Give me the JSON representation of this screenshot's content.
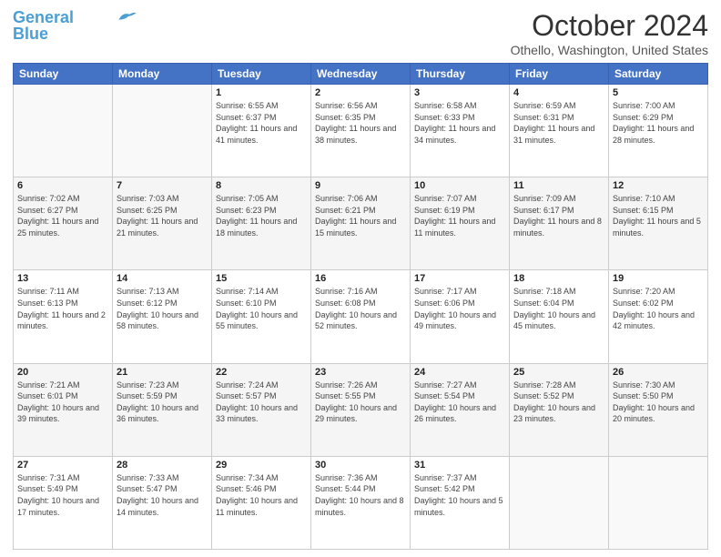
{
  "logo": {
    "line1": "General",
    "line2": "Blue"
  },
  "title": "October 2024",
  "location": "Othello, Washington, United States",
  "days_of_week": [
    "Sunday",
    "Monday",
    "Tuesday",
    "Wednesday",
    "Thursday",
    "Friday",
    "Saturday"
  ],
  "weeks": [
    [
      {
        "day": "",
        "info": ""
      },
      {
        "day": "",
        "info": ""
      },
      {
        "day": "1",
        "sunrise": "6:55 AM",
        "sunset": "6:37 PM",
        "daylight": "11 hours and 41 minutes."
      },
      {
        "day": "2",
        "sunrise": "6:56 AM",
        "sunset": "6:35 PM",
        "daylight": "11 hours and 38 minutes."
      },
      {
        "day": "3",
        "sunrise": "6:58 AM",
        "sunset": "6:33 PM",
        "daylight": "11 hours and 34 minutes."
      },
      {
        "day": "4",
        "sunrise": "6:59 AM",
        "sunset": "6:31 PM",
        "daylight": "11 hours and 31 minutes."
      },
      {
        "day": "5",
        "sunrise": "7:00 AM",
        "sunset": "6:29 PM",
        "daylight": "11 hours and 28 minutes."
      }
    ],
    [
      {
        "day": "6",
        "sunrise": "7:02 AM",
        "sunset": "6:27 PM",
        "daylight": "11 hours and 25 minutes."
      },
      {
        "day": "7",
        "sunrise": "7:03 AM",
        "sunset": "6:25 PM",
        "daylight": "11 hours and 21 minutes."
      },
      {
        "day": "8",
        "sunrise": "7:05 AM",
        "sunset": "6:23 PM",
        "daylight": "11 hours and 18 minutes."
      },
      {
        "day": "9",
        "sunrise": "7:06 AM",
        "sunset": "6:21 PM",
        "daylight": "11 hours and 15 minutes."
      },
      {
        "day": "10",
        "sunrise": "7:07 AM",
        "sunset": "6:19 PM",
        "daylight": "11 hours and 11 minutes."
      },
      {
        "day": "11",
        "sunrise": "7:09 AM",
        "sunset": "6:17 PM",
        "daylight": "11 hours and 8 minutes."
      },
      {
        "day": "12",
        "sunrise": "7:10 AM",
        "sunset": "6:15 PM",
        "daylight": "11 hours and 5 minutes."
      }
    ],
    [
      {
        "day": "13",
        "sunrise": "7:11 AM",
        "sunset": "6:13 PM",
        "daylight": "11 hours and 2 minutes."
      },
      {
        "day": "14",
        "sunrise": "7:13 AM",
        "sunset": "6:12 PM",
        "daylight": "10 hours and 58 minutes."
      },
      {
        "day": "15",
        "sunrise": "7:14 AM",
        "sunset": "6:10 PM",
        "daylight": "10 hours and 55 minutes."
      },
      {
        "day": "16",
        "sunrise": "7:16 AM",
        "sunset": "6:08 PM",
        "daylight": "10 hours and 52 minutes."
      },
      {
        "day": "17",
        "sunrise": "7:17 AM",
        "sunset": "6:06 PM",
        "daylight": "10 hours and 49 minutes."
      },
      {
        "day": "18",
        "sunrise": "7:18 AM",
        "sunset": "6:04 PM",
        "daylight": "10 hours and 45 minutes."
      },
      {
        "day": "19",
        "sunrise": "7:20 AM",
        "sunset": "6:02 PM",
        "daylight": "10 hours and 42 minutes."
      }
    ],
    [
      {
        "day": "20",
        "sunrise": "7:21 AM",
        "sunset": "6:01 PM",
        "daylight": "10 hours and 39 minutes."
      },
      {
        "day": "21",
        "sunrise": "7:23 AM",
        "sunset": "5:59 PM",
        "daylight": "10 hours and 36 minutes."
      },
      {
        "day": "22",
        "sunrise": "7:24 AM",
        "sunset": "5:57 PM",
        "daylight": "10 hours and 33 minutes."
      },
      {
        "day": "23",
        "sunrise": "7:26 AM",
        "sunset": "5:55 PM",
        "daylight": "10 hours and 29 minutes."
      },
      {
        "day": "24",
        "sunrise": "7:27 AM",
        "sunset": "5:54 PM",
        "daylight": "10 hours and 26 minutes."
      },
      {
        "day": "25",
        "sunrise": "7:28 AM",
        "sunset": "5:52 PM",
        "daylight": "10 hours and 23 minutes."
      },
      {
        "day": "26",
        "sunrise": "7:30 AM",
        "sunset": "5:50 PM",
        "daylight": "10 hours and 20 minutes."
      }
    ],
    [
      {
        "day": "27",
        "sunrise": "7:31 AM",
        "sunset": "5:49 PM",
        "daylight": "10 hours and 17 minutes."
      },
      {
        "day": "28",
        "sunrise": "7:33 AM",
        "sunset": "5:47 PM",
        "daylight": "10 hours and 14 minutes."
      },
      {
        "day": "29",
        "sunrise": "7:34 AM",
        "sunset": "5:46 PM",
        "daylight": "10 hours and 11 minutes."
      },
      {
        "day": "30",
        "sunrise": "7:36 AM",
        "sunset": "5:44 PM",
        "daylight": "10 hours and 8 minutes."
      },
      {
        "day": "31",
        "sunrise": "7:37 AM",
        "sunset": "5:42 PM",
        "daylight": "10 hours and 5 minutes."
      },
      {
        "day": "",
        "info": ""
      },
      {
        "day": "",
        "info": ""
      }
    ]
  ]
}
